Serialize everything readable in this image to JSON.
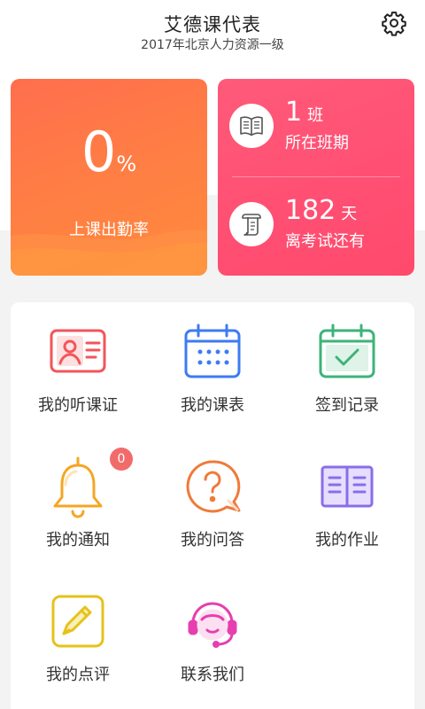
{
  "header": {
    "title": "艾德课代表",
    "subtitle": "2017年北京人力资源一级",
    "settings_icon": "gear-icon"
  },
  "attendance": {
    "value": "0",
    "unit": "%",
    "label": "上课出勤率"
  },
  "stats": {
    "class": {
      "value": "1",
      "unit": "班",
      "label": "所在班期",
      "icon": "book-icon"
    },
    "exam": {
      "value": "182",
      "unit": "天",
      "label": "离考试还有",
      "icon": "scroll-icon"
    }
  },
  "menu": {
    "items": [
      {
        "label": "我的听课证",
        "icon": "id-card-icon",
        "color": "#f2555b"
      },
      {
        "label": "我的课表",
        "icon": "calendar-icon",
        "color": "#3d7bf2"
      },
      {
        "label": "签到记录",
        "icon": "calendar-check-icon",
        "color": "#3db37a"
      },
      {
        "label": "我的通知",
        "icon": "bell-icon",
        "color": "#f5a623"
      },
      {
        "label": "我的问答",
        "icon": "question-bubble-icon",
        "color": "#f07a3a"
      },
      {
        "label": "我的作业",
        "icon": "open-book-icon",
        "color": "#8a6de9"
      },
      {
        "label": "我的点评",
        "icon": "pencil-icon",
        "color": "#e6c21a"
      },
      {
        "label": "联系我们",
        "icon": "headset-icon",
        "color": "#e63fb0"
      }
    ],
    "notification_badge": "0"
  },
  "colors": {
    "orange_card": "#ff7d45",
    "pink_card": "#ff4f73",
    "page_bg": "#f3f3f3"
  }
}
